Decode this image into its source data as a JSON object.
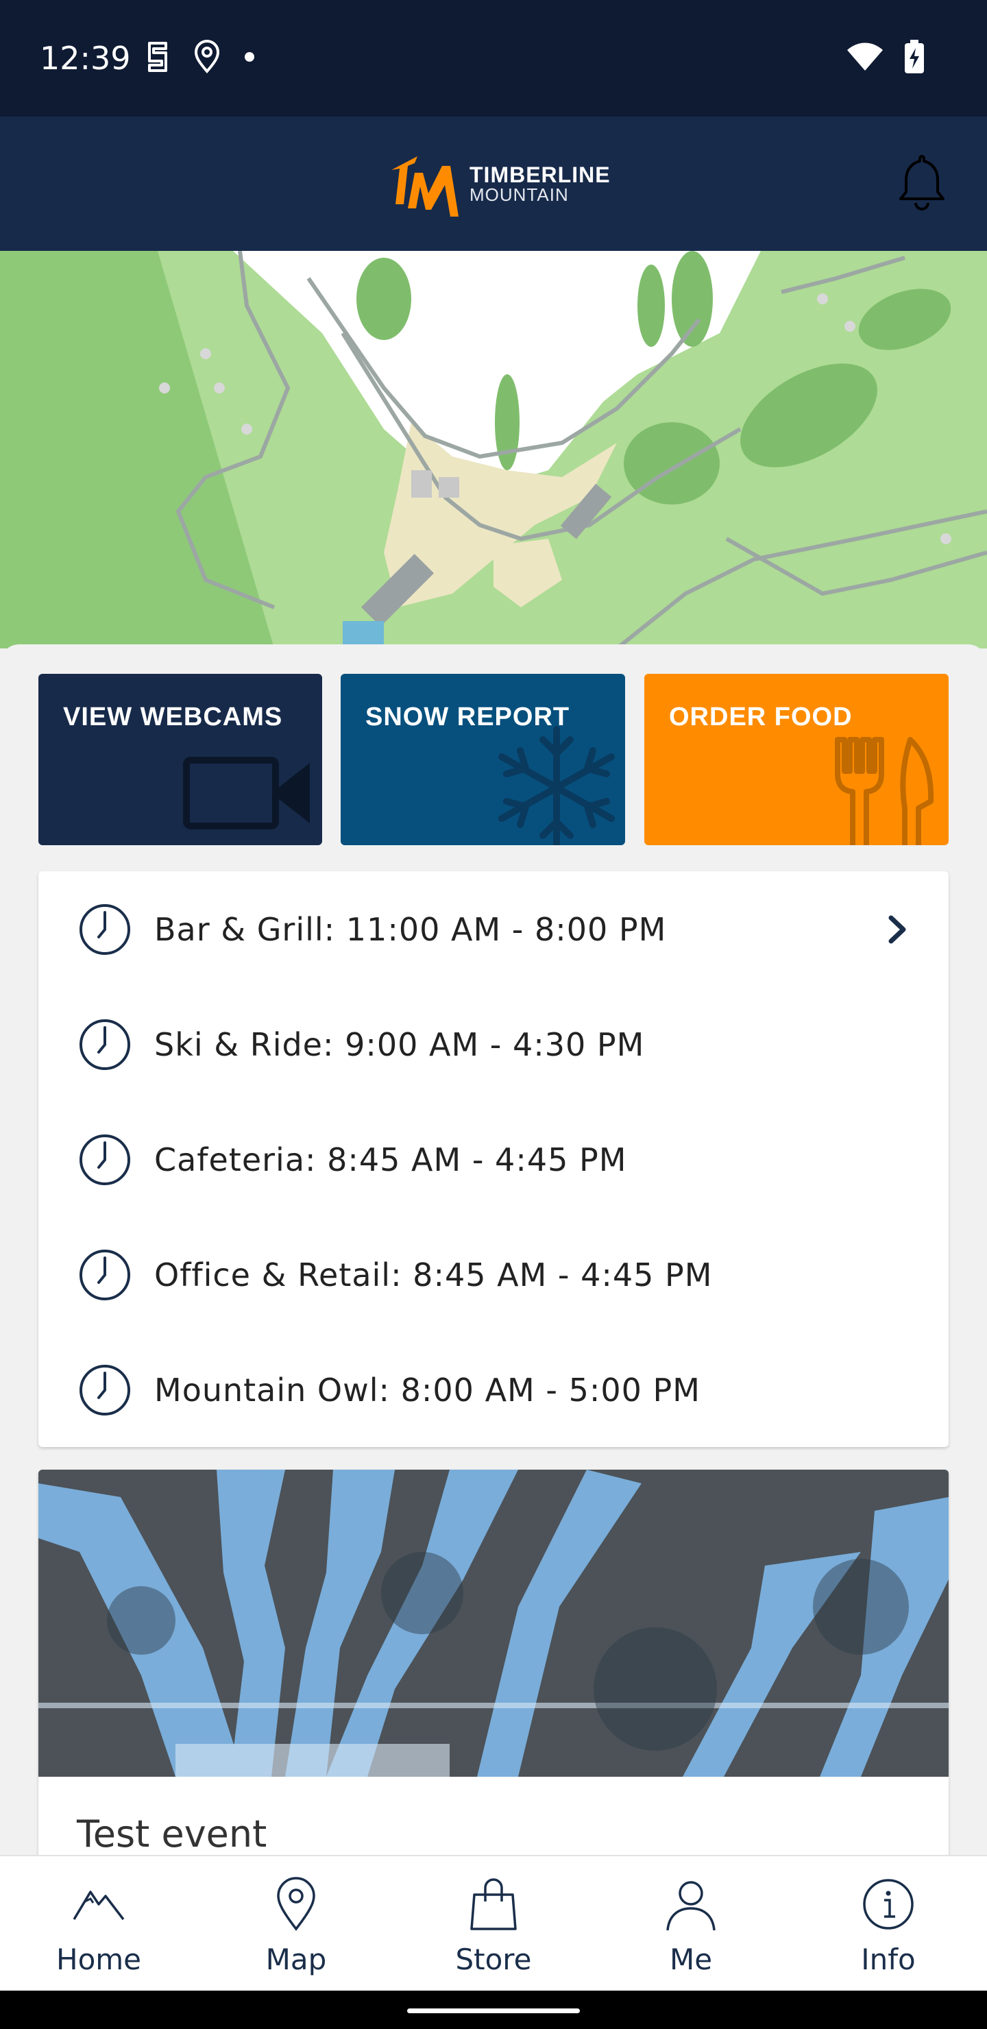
{
  "status_bar": {
    "time": "12:39",
    "left_icons": [
      "sim-icon",
      "location-icon",
      "dot-icon"
    ],
    "right_icons": [
      "wifi-icon",
      "battery-charging-icon"
    ]
  },
  "header": {
    "logo_mark": "TM",
    "logo_line1": "TIMBERLINE",
    "logo_line2": "MOUNTAIN",
    "notification_icon": "bell-icon",
    "brand_navy": "#172a4a",
    "brand_orange": "#ff8c00"
  },
  "quick_actions": [
    {
      "label": "VIEW WEBCAMS",
      "icon": "video-camera-icon",
      "color": "#172a4a"
    },
    {
      "label": "SNOW REPORT",
      "icon": "snowflake-icon",
      "color": "#07507e"
    },
    {
      "label": "ORDER FOOD",
      "icon": "fork-knife-icon",
      "color": "#ff8c00"
    }
  ],
  "hours": [
    {
      "text": "Bar & Grill: 11:00 AM - 8:00 PM"
    },
    {
      "text": "Ski & Ride: 9:00 AM - 4:30 PM"
    },
    {
      "text": "Cafeteria: 8:45 AM - 4:45 PM"
    },
    {
      "text": "Office & Retail: 8:45 AM - 4:45 PM"
    },
    {
      "text": "Mountain Owl: 8:00 AM - 5:00 PM"
    }
  ],
  "event": {
    "title": "Test event"
  },
  "bottom_nav": [
    {
      "label": "Home",
      "icon": "mountain-icon"
    },
    {
      "label": "Map",
      "icon": "map-pin-icon"
    },
    {
      "label": "Store",
      "icon": "shopping-bag-icon"
    },
    {
      "label": "Me",
      "icon": "person-icon"
    },
    {
      "label": "Info",
      "icon": "info-icon"
    }
  ]
}
